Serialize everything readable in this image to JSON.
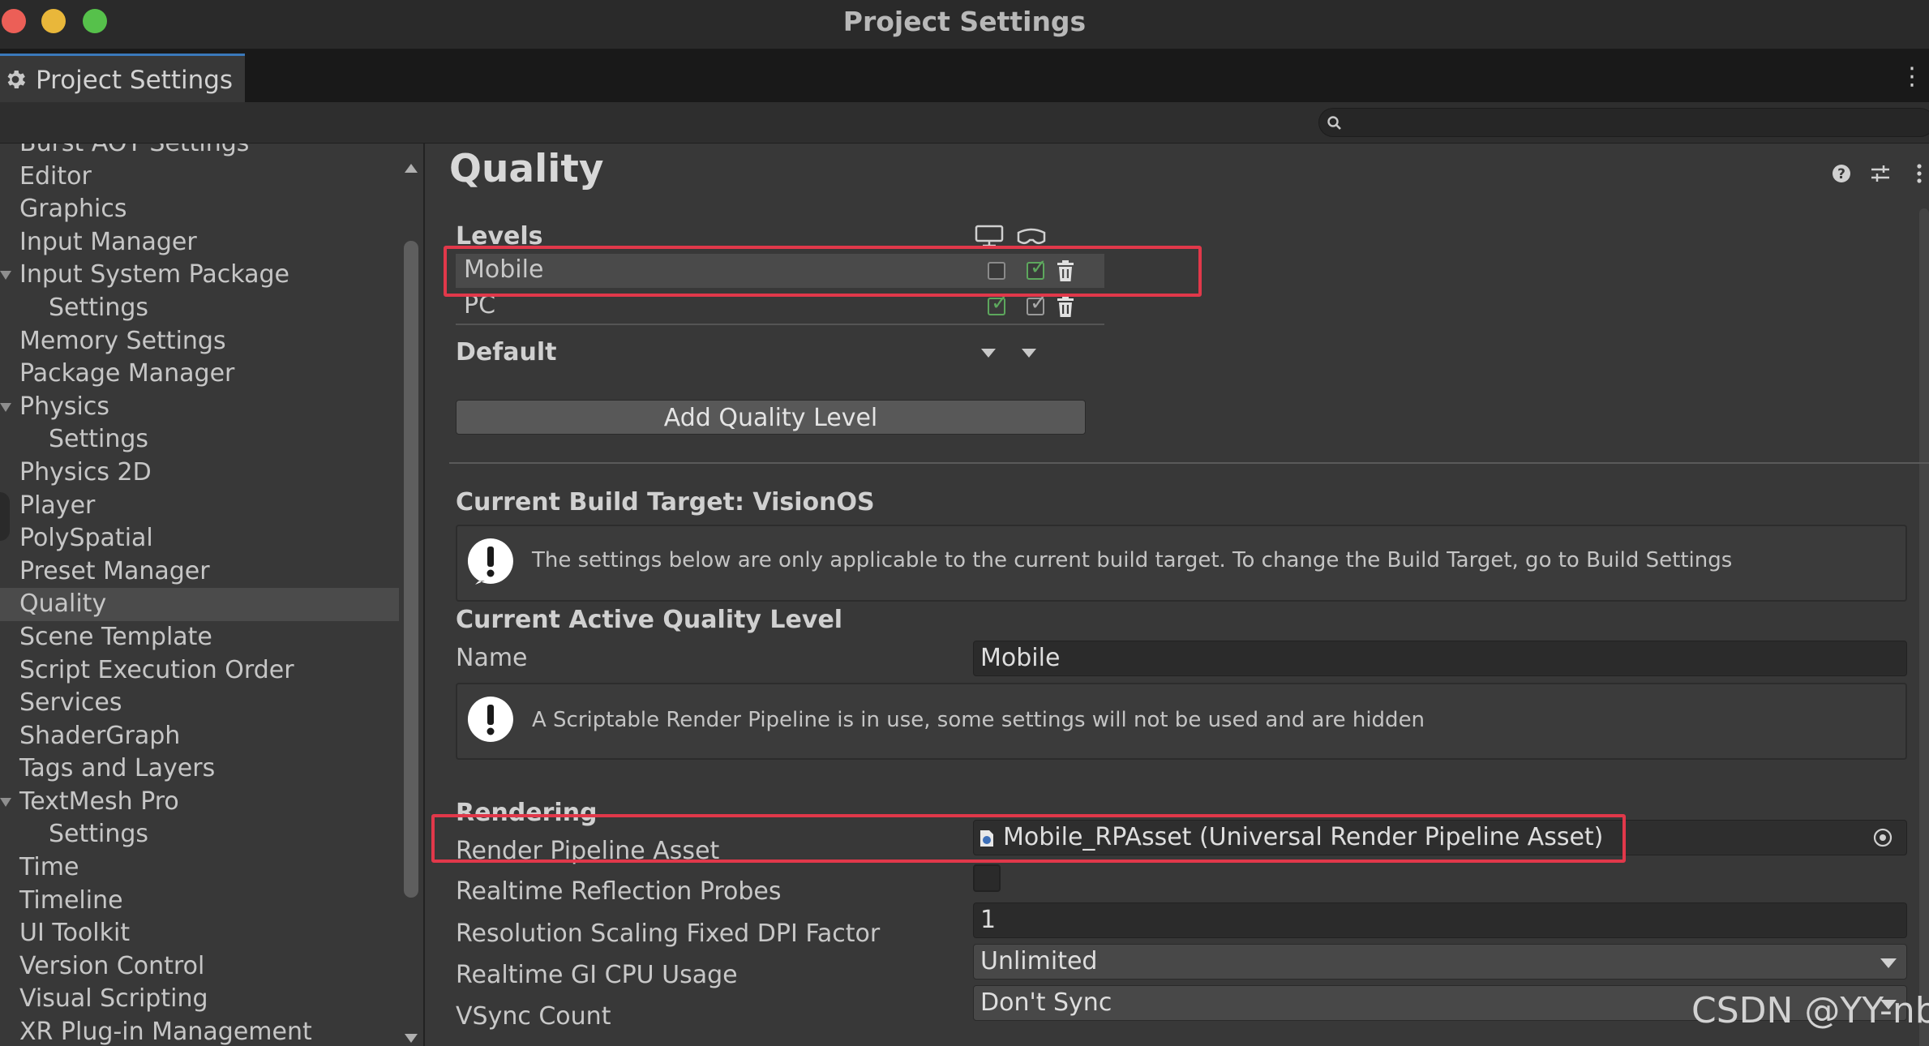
{
  "window": {
    "title": "Project Settings"
  },
  "tab": {
    "label": "Project Settings"
  },
  "search": {
    "placeholder": "",
    "value": ""
  },
  "sidebar": {
    "items": [
      {
        "label": "Burst AOT Settings",
        "level": 0
      },
      {
        "label": "Editor",
        "level": 0
      },
      {
        "label": "Graphics",
        "level": 0
      },
      {
        "label": "Input Manager",
        "level": 0
      },
      {
        "label": "Input System Package",
        "level": 0,
        "expanded": true
      },
      {
        "label": "Settings",
        "level": 1
      },
      {
        "label": "Memory Settings",
        "level": 0
      },
      {
        "label": "Package Manager",
        "level": 0
      },
      {
        "label": "Physics",
        "level": 0,
        "expanded": true
      },
      {
        "label": "Settings",
        "level": 1
      },
      {
        "label": "Physics 2D",
        "level": 0
      },
      {
        "label": "Player",
        "level": 0
      },
      {
        "label": "PolySpatial",
        "level": 0
      },
      {
        "label": "Preset Manager",
        "level": 0
      },
      {
        "label": "Quality",
        "level": 0,
        "selected": true
      },
      {
        "label": "Scene Template",
        "level": 0
      },
      {
        "label": "Script Execution Order",
        "level": 0
      },
      {
        "label": "Services",
        "level": 0
      },
      {
        "label": "ShaderGraph",
        "level": 0
      },
      {
        "label": "Tags and Layers",
        "level": 0
      },
      {
        "label": "TextMesh Pro",
        "level": 0,
        "expanded": true
      },
      {
        "label": "Settings",
        "level": 1
      },
      {
        "label": "Time",
        "level": 0
      },
      {
        "label": "Timeline",
        "level": 0
      },
      {
        "label": "UI Toolkit",
        "level": 0
      },
      {
        "label": "Version Control",
        "level": 0
      },
      {
        "label": "Visual Scripting",
        "level": 0
      },
      {
        "label": "XR Plug-in Management",
        "level": 0
      }
    ]
  },
  "main": {
    "title": "Quality",
    "levels": {
      "heading": "Levels",
      "columns": [
        "monitor-icon",
        "headset-icon"
      ],
      "rows": [
        {
          "name": "Mobile",
          "standalone_enabled": false,
          "visionos_enabled": true,
          "selected": true
        },
        {
          "name": "PC",
          "standalone_enabled": true,
          "visionos_enabled": true,
          "selected": false
        }
      ],
      "default_label": "Default"
    },
    "add_button": "Add Quality Level",
    "build_target": {
      "heading": "Current Build Target: VisionOS",
      "message": "The settings below are only applicable to the current build target. To change the Build Target, go to Build Settings"
    },
    "active_level": {
      "heading": "Current Active Quality Level",
      "name_label": "Name",
      "name_value": "Mobile",
      "srp_message": "A Scriptable Render Pipeline is in use, some settings will not be used and are hidden"
    },
    "rendering": {
      "heading": "Rendering",
      "render_pipeline_label": "Render Pipeline Asset",
      "render_pipeline_value": "Mobile_RPAsset (Universal Render Pipeline Asset)",
      "reflection_probes_label": "Realtime Reflection Probes",
      "reflection_probes_value": false,
      "dpi_label": "Resolution Scaling Fixed DPI Factor",
      "dpi_value": "1",
      "gi_label": "Realtime GI CPU Usage",
      "gi_value": "Unlimited",
      "vsync_label": "VSync Count",
      "vsync_value": "Don't Sync"
    }
  },
  "colors": {
    "highlight": "#e1384a",
    "check_green": "#5da75d",
    "accent_tab": "#3a79bb"
  },
  "watermark": "CSDN @YY-nb"
}
